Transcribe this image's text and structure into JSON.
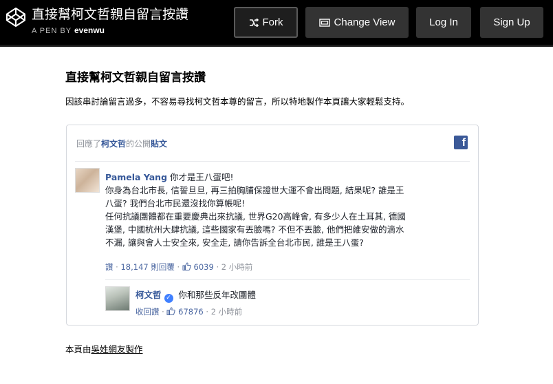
{
  "header": {
    "title": "直接幫柯文哲親自留言按讚",
    "by_prefix": "A PEN BY",
    "author": "evenwu",
    "buttons": {
      "fork": "Fork",
      "change_view": "Change View",
      "login": "Log In",
      "signup": "Sign Up"
    }
  },
  "main": {
    "title": "直接幫柯文哲親自留言按讚",
    "intro": "因該串討論留言過多，不容易尋找柯文哲本尊的留言，所以特地製作本頁讓大家輕鬆支持。"
  },
  "embed": {
    "head": {
      "prefix": "回應了",
      "page_name": "柯文哲",
      "middle": "的公開",
      "post_word": "貼文"
    },
    "comment": {
      "author": "Pamela Yang",
      "lines": [
        "你才是王八蛋吧!",
        "你身為台北市長, 信誓旦旦, 再三拍胸脯保證世大運不會出問題, 結果呢? 誰是王",
        "八蛋? 我們台北市民還沒找你算帳呢!",
        "任何抗議團體都在重要慶典出來抗議, 世界G20高峰會, 有多少人在土耳其, 德國",
        "漢堡, 中國杭州大肆抗議, 這些國家有丟臉嗎? 不但不丟臉, 他們把維安做的滴水",
        "不漏, 讓與會人士安全來, 安全走, 請你告訴全台北市民, 誰是王八蛋?"
      ],
      "reply_label": "讚",
      "replies_count": "18,147 則回覆",
      "likes": "6039",
      "time": "2 小時前"
    },
    "reply": {
      "author": "柯文哲",
      "text": "你和那些反年改團體",
      "reply_label": "收回讚",
      "likes": "67876",
      "time": "2 小時前"
    }
  },
  "footer": {
    "prefix": "本頁由",
    "link": "吳姓網友製作"
  }
}
